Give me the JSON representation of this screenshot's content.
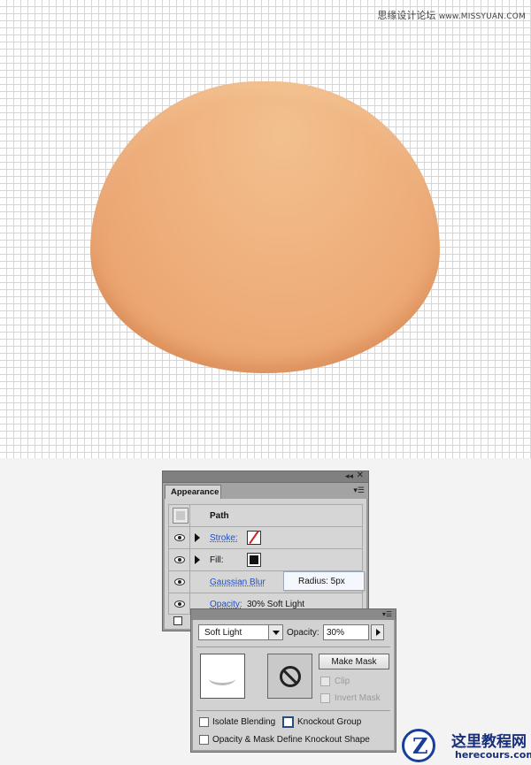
{
  "watermark_top": {
    "cn": "思缘设计论坛",
    "url": "www.MISSYUAN.COM"
  },
  "colors": {
    "dome_light": "#f2c08e",
    "dome_dark": "#d98852",
    "link_blue": "#1f4fc0",
    "grid_line": "#d6d6d6"
  },
  "appearance_panel": {
    "tab_label": "Appearance",
    "rows": {
      "path": "Path",
      "stroke": "Stroke:",
      "fill": "Fill:",
      "effect": "Gaussian Blur",
      "opacity_label": "Opacity:",
      "opacity_value": "30% Soft Light"
    },
    "icons": [
      "collapse-icon",
      "close-icon",
      "panel-menu-icon",
      "eye-icon",
      "expand-triangle-icon"
    ]
  },
  "tooltip": {
    "text": "Radius: 5px"
  },
  "transparency_panel": {
    "blend_mode": "Soft Light",
    "opacity_label": "Opacity:",
    "opacity_value": "30%",
    "make_mask_label": "Make Mask",
    "clip_label": "Clip",
    "invert_mask_label": "Invert Mask",
    "isolate_blending_label": "Isolate Blending",
    "knockout_group_label": "Knockout Group",
    "opacity_mask_label": "Opacity & Mask Define Knockout Shape"
  },
  "logo": {
    "title": "这里教程网",
    "url": "herecours.com"
  }
}
